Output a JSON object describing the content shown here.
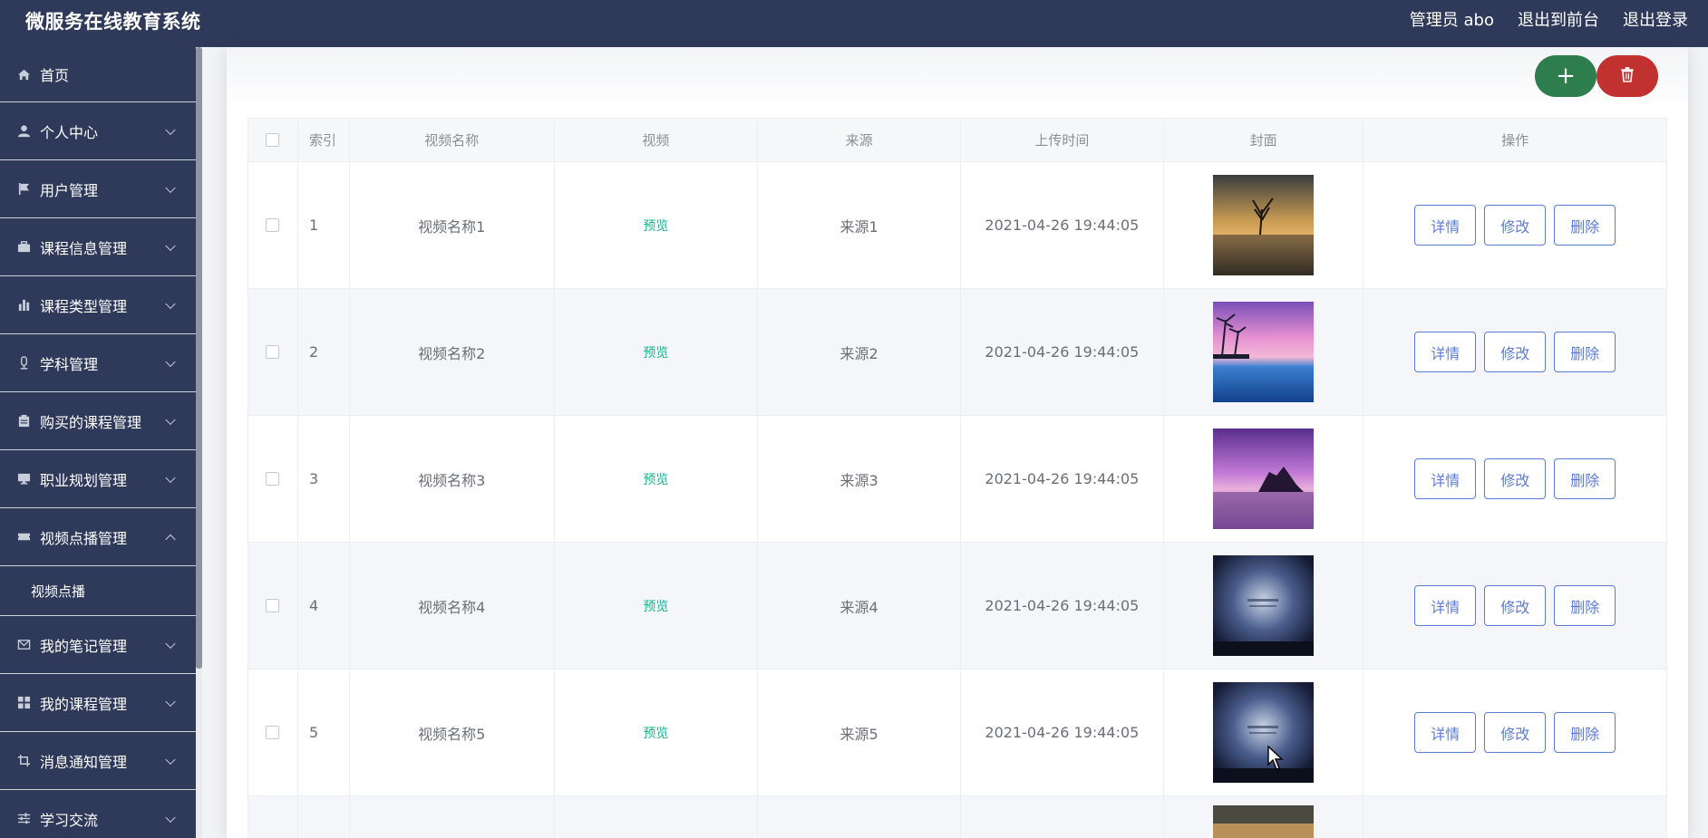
{
  "header": {
    "title": "微服务在线教育系统",
    "admin": "管理员 abo",
    "to_front": "退出到前台",
    "logout": "退出登录"
  },
  "sidebar": {
    "items": [
      {
        "label": "首页",
        "icon": "home-icon"
      },
      {
        "label": "个人中心",
        "icon": "user-icon"
      },
      {
        "label": "用户管理",
        "icon": "flag-icon"
      },
      {
        "label": "课程信息管理",
        "icon": "briefcase-icon"
      },
      {
        "label": "课程类型管理",
        "icon": "bar-chart-icon"
      },
      {
        "label": "学科管理",
        "icon": "microphone-icon"
      },
      {
        "label": "购买的课程管理",
        "icon": "clipboard-icon"
      },
      {
        "label": "职业规划管理",
        "icon": "monitor-icon"
      },
      {
        "label": "视频点播管理",
        "icon": "ticket-icon"
      },
      {
        "label": "我的笔记管理",
        "icon": "mail-icon"
      },
      {
        "label": "我的课程管理",
        "icon": "grid-icon"
      },
      {
        "label": "消息通知管理",
        "icon": "crop-icon"
      },
      {
        "label": "学习交流",
        "icon": "sliders-icon"
      }
    ],
    "submenu": {
      "label": "视频点播"
    }
  },
  "toolbar": {
    "add_label": "+",
    "delete_icon": "trash-icon"
  },
  "table": {
    "headers": [
      "索引",
      "视频名称",
      "视频",
      "来源",
      "上传时间",
      "封面",
      "操作"
    ],
    "rows": [
      {
        "index": "1",
        "name": "视频名称1",
        "video": "预览",
        "source": "来源1",
        "time": "2021-04-26 19:44:05",
        "cover": "sunset-tree"
      },
      {
        "index": "2",
        "name": "视频名称2",
        "video": "预览",
        "source": "来源2",
        "time": "2021-04-26 19:44:05",
        "cover": "pink-beach"
      },
      {
        "index": "3",
        "name": "视频名称3",
        "video": "预览",
        "source": "来源3",
        "time": "2021-04-26 19:44:05",
        "cover": "purple-sea"
      },
      {
        "index": "4",
        "name": "视频名称4",
        "video": "预览",
        "source": "来源4",
        "time": "2021-04-26 19:44:05",
        "cover": "night-sky"
      },
      {
        "index": "5",
        "name": "视频名称5",
        "video": "预览",
        "source": "来源5",
        "time": "2021-04-26 19:44:05",
        "cover": "night-sky"
      }
    ],
    "actions": {
      "detail": "详情",
      "edit": "修改",
      "delete": "删除"
    }
  },
  "colors": {
    "nav_bg": "#2f3a5a",
    "add": "#2e7d4c",
    "delete": "#c0312f",
    "link": "#17b38c",
    "action": "#5b7bd5"
  }
}
